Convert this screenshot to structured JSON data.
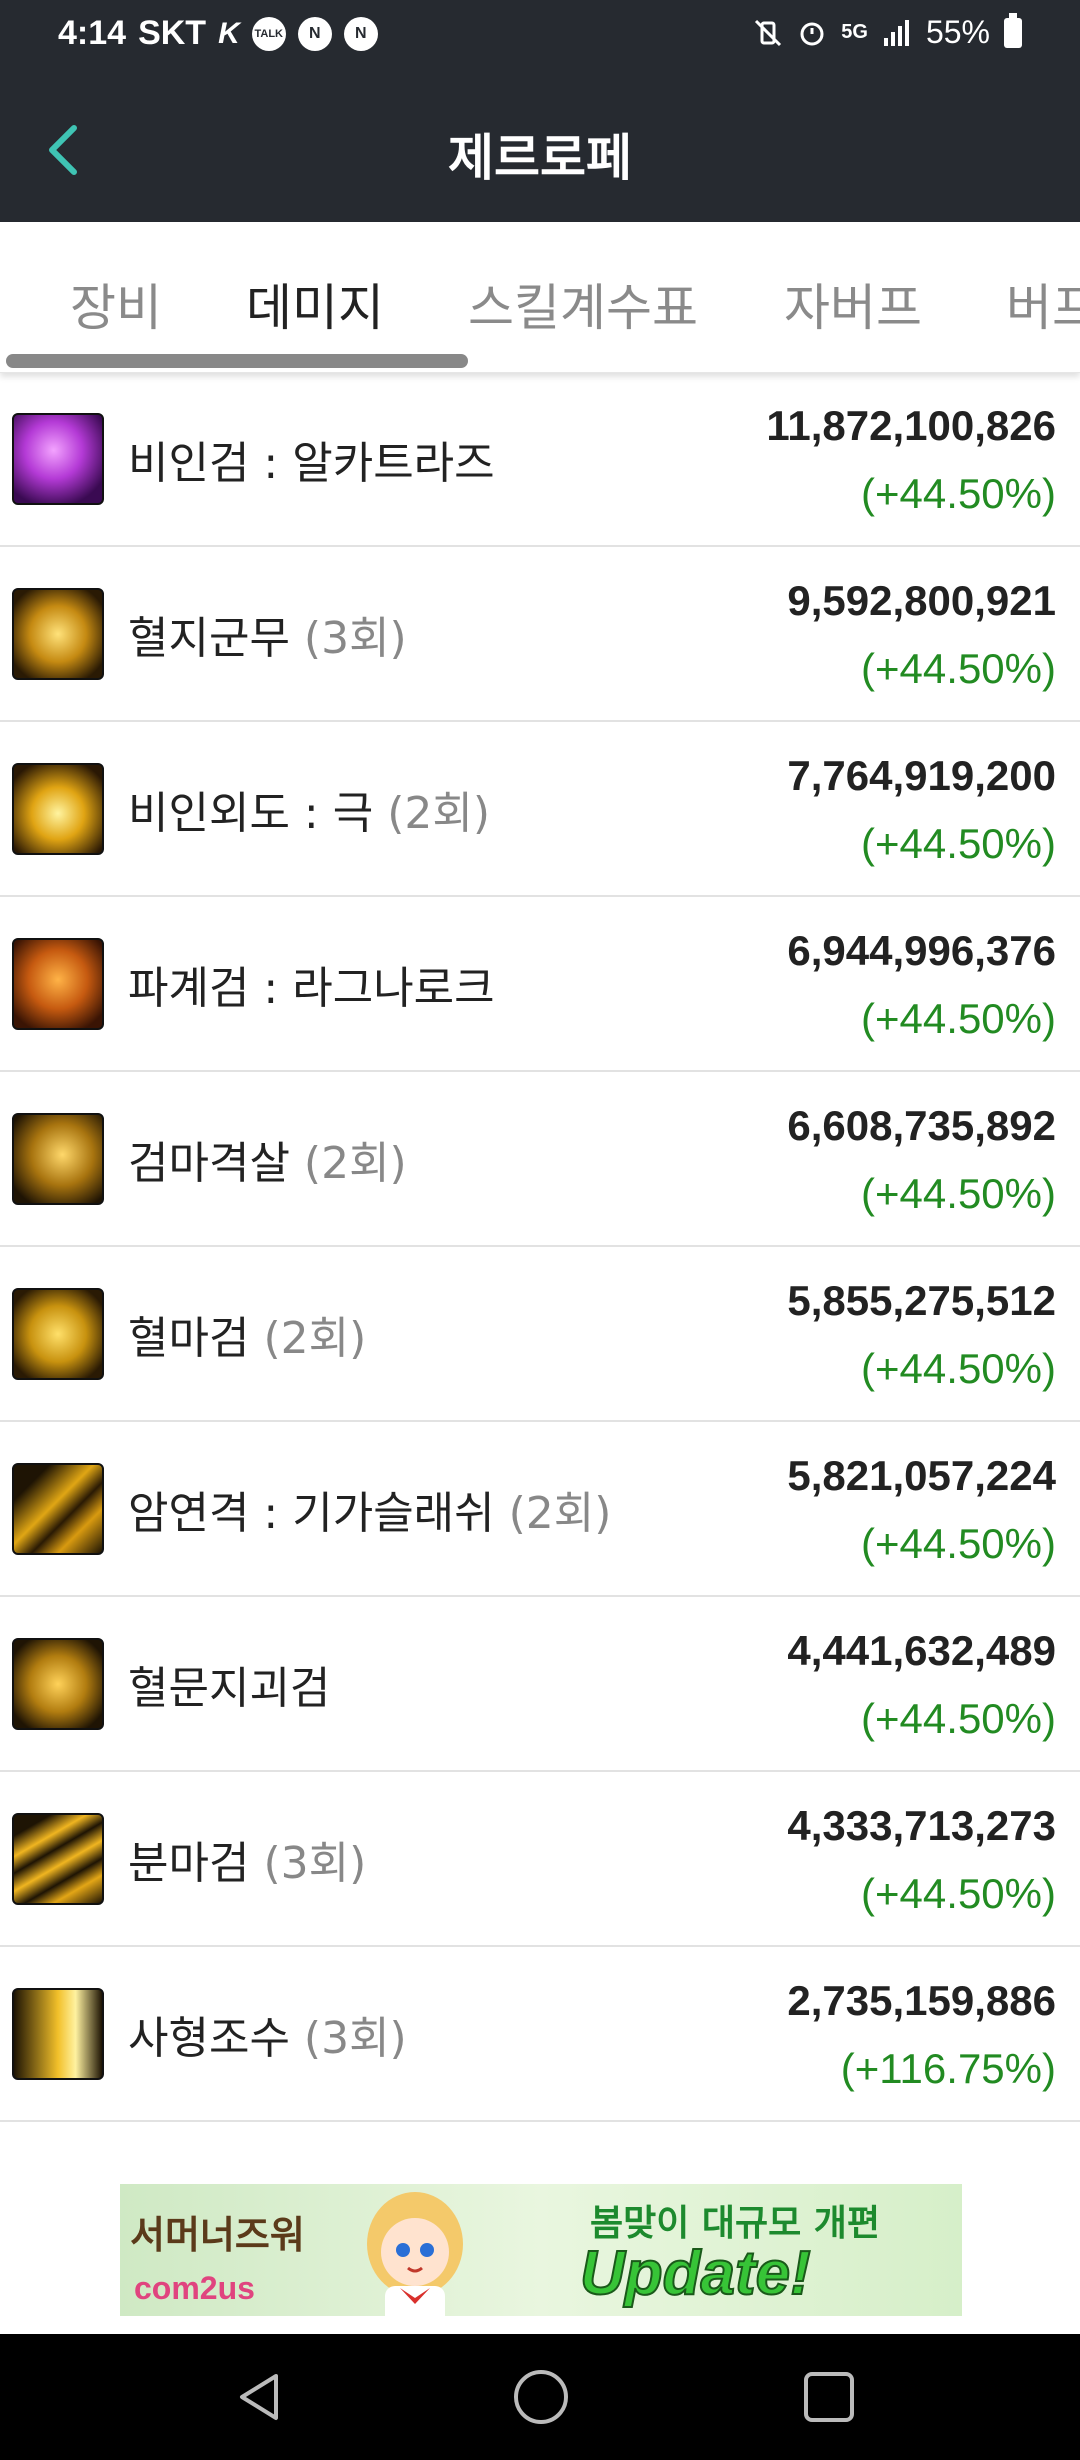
{
  "status_bar": {
    "time": "4:14",
    "carrier": "SKT",
    "notification_icons": [
      "k-icon",
      "talk-icon",
      "naver-icon",
      "naver-icon"
    ],
    "talk": "TALK",
    "n": "N",
    "network": "5G",
    "battery": "55%"
  },
  "header": {
    "title": "제르로페"
  },
  "tabs": [
    {
      "label": "장비"
    },
    {
      "label": "데미지"
    },
    {
      "label": "스킬계수표"
    },
    {
      "label": "자버프"
    },
    {
      "label": "버프"
    }
  ],
  "active_tab": "데미지",
  "skills": [
    {
      "name": "비인검 : 알카트라즈",
      "count": "",
      "damage": "11,872,100,826",
      "percent": "(+44.50%)",
      "icon": "purple-slash-icon"
    },
    {
      "name": "혈지군무",
      "count": "(3회)",
      "damage": "9,592,800,921",
      "percent": "(+44.50%)",
      "icon": "dance-figure-icon"
    },
    {
      "name": "비인외도 : 극",
      "count": "(2회)",
      "damage": "7,764,919,200",
      "percent": "(+44.50%)",
      "icon": "burst-icon"
    },
    {
      "name": "파계검 : 라그나로크",
      "count": "",
      "damage": "6,944,996,376",
      "percent": "(+44.50%)",
      "icon": "demon-face-icon"
    },
    {
      "name": "검마격살",
      "count": "(2회)",
      "damage": "6,608,735,892",
      "percent": "(+44.50%)",
      "icon": "dragon-head-icon"
    },
    {
      "name": "혈마검",
      "count": "(2회)",
      "damage": "5,855,275,512",
      "percent": "(+44.50%)",
      "icon": "swirl-slash-icon"
    },
    {
      "name": "암연격 : 기가슬래쉬",
      "count": "(2회)",
      "damage": "5,821,057,224",
      "percent": "(+44.50%)",
      "icon": "claw-slash-icon"
    },
    {
      "name": "혈문지괴검",
      "count": "",
      "damage": "4,441,632,489",
      "percent": "(+44.50%)",
      "icon": "beast-icon"
    },
    {
      "name": "분마검",
      "count": "(3회)",
      "damage": "4,333,713,273",
      "percent": "(+44.50%)",
      "icon": "triple-slash-icon"
    },
    {
      "name": "사형조수",
      "count": "(3회)",
      "damage": "2,735,159,886",
      "percent": "(+116.75%)",
      "icon": "spiked-arrow-icon"
    }
  ],
  "ad": {
    "logo": "서머너즈워",
    "brand": "com2us",
    "headline": "봄맞이 대규모 개편",
    "cta": "Update!"
  },
  "colors": {
    "header_bg": "#262a30",
    "back_arrow": "#3fc4b4",
    "percent_green": "#228b22"
  }
}
